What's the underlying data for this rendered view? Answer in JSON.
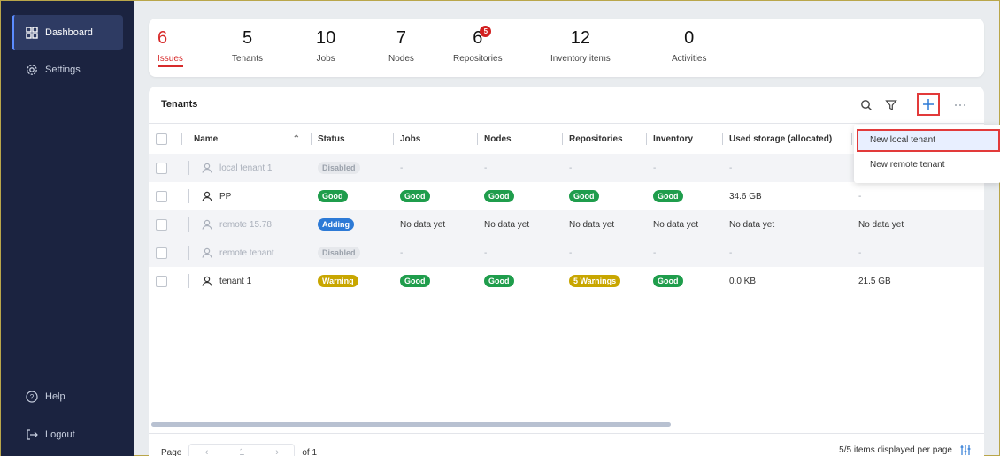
{
  "sidebar": {
    "items": [
      {
        "label": "Dashboard",
        "icon": "dashboard-icon",
        "active": true
      },
      {
        "label": "Settings",
        "icon": "gear-icon"
      }
    ],
    "bottom": [
      {
        "label": "Help",
        "icon": "help-icon"
      },
      {
        "label": "Logout",
        "icon": "logout-icon"
      }
    ]
  },
  "stats": [
    {
      "value": "6",
      "label": "Issues"
    },
    {
      "value": "5",
      "label": "Tenants"
    },
    {
      "value": "10",
      "label": "Jobs"
    },
    {
      "value": "7",
      "label": "Nodes"
    },
    {
      "value": "6",
      "label": "Repositories",
      "badge": "5"
    },
    {
      "value": "12",
      "label": "Inventory items"
    },
    {
      "value": "0",
      "label": "Activities"
    }
  ],
  "tenants": {
    "title": "Tenants",
    "columns": [
      "Name",
      "Status",
      "Jobs",
      "Nodes",
      "Repositories",
      "Inventory",
      "Used storage (allocated)",
      ""
    ],
    "rows": [
      {
        "name": "local tenant 1",
        "status": "Disabled",
        "jobs": "-",
        "nodes": "-",
        "repositories": "-",
        "inventory": "-",
        "used": "-",
        "extra": ""
      },
      {
        "name": "PP",
        "status": "Good",
        "jobs": "Good",
        "nodes": "Good",
        "repositories": "Good",
        "inventory": "Good",
        "used": "34.6 GB",
        "extra": "-"
      },
      {
        "name": "remote 15.78",
        "status": "Adding",
        "jobs": "No data yet",
        "nodes": "No data yet",
        "repositories": "No data yet",
        "inventory": "No data yet",
        "used": "No data yet",
        "extra": "No data yet"
      },
      {
        "name": "remote tenant",
        "status": "Disabled",
        "jobs": "-",
        "nodes": "-",
        "repositories": "-",
        "inventory": "-",
        "used": "-",
        "extra": "-"
      },
      {
        "name": "tenant 1",
        "status": "Warning",
        "jobs": "Good",
        "nodes": "Good",
        "repositories": "5 Warnings",
        "inventory": "Good",
        "used": "0.0 KB",
        "extra": "21.5 GB"
      }
    ]
  },
  "menu": {
    "items": [
      "New local tenant",
      "New remote tenant"
    ]
  },
  "footer": {
    "page_label": "Page",
    "page_value": "1",
    "page_of": "of 1",
    "items_text": "5/5 items displayed per page"
  },
  "colors": {
    "accent": "#2d7ad6",
    "good": "#1f9d4c",
    "warning": "#c8a600",
    "issue": "#d72b2b",
    "sidebar": "#1b2340"
  }
}
